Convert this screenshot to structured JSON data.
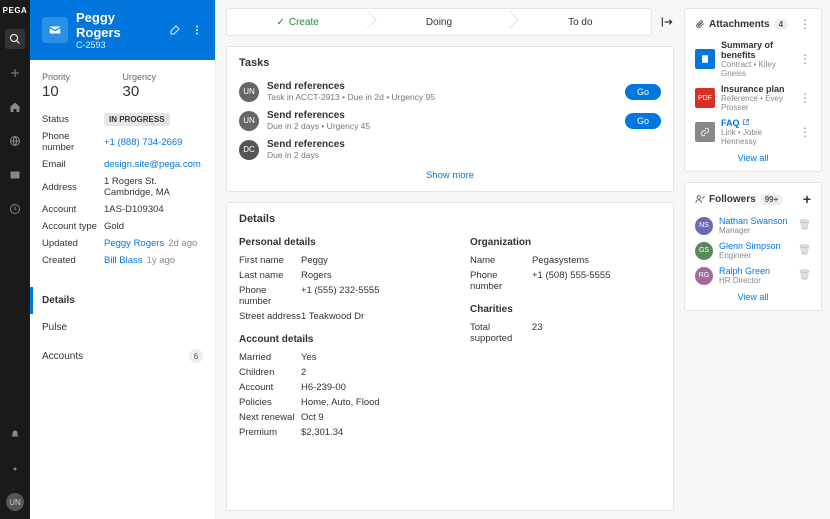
{
  "brand": "PEGA",
  "user_avatar": "UN",
  "case": {
    "title": "Peggy Rogers",
    "id": "C-2593",
    "priority_label": "Priority",
    "priority": "10",
    "urgency_label": "Urgency",
    "urgency": "30",
    "fields": {
      "status_k": "Status",
      "status_v": "IN PROGRESS",
      "phone_k": "Phone number",
      "phone_v": "+1 (888) 734-2669",
      "email_k": "Email",
      "email_v": "design.site@pega.com",
      "address_k": "Address",
      "address_v": "1 Rogers St. Cambridge, MA",
      "account_k": "Account",
      "account_v": "1AS-D109304",
      "accttype_k": "Account type",
      "accttype_v": "Gold",
      "updated_k": "Updated",
      "updated_v": "Peggy Rogers",
      "updated_ago": "2d ago",
      "created_k": "Created",
      "created_v": "Bill Blass",
      "created_ago": "1y ago"
    }
  },
  "side_tabs": {
    "details": "Details",
    "pulse": "Pulse",
    "accounts": "Accounts",
    "accounts_count": "6"
  },
  "stages": {
    "s1": "Create",
    "s2": "Doing",
    "s3": "To do"
  },
  "tasks": {
    "heading": "Tasks",
    "t1": {
      "av": "UN",
      "title": "Send references",
      "sub": "Task in ACCT-2913 • Due in 2d • Urgency 95",
      "btn": "Go"
    },
    "t2": {
      "av": "UN",
      "title": "Send references",
      "sub": "Due in 2 days • Urgency 45",
      "btn": "Go"
    },
    "t3": {
      "av": "DC",
      "title": "Send references",
      "sub": "Due in 2 days"
    },
    "show_more": "Show more"
  },
  "details": {
    "heading": "Details",
    "personal_h": "Personal details",
    "first_k": "First name",
    "first_v": "Peggy",
    "last_k": "Last name",
    "last_v": "Rogers",
    "phone_k": "Phone number",
    "phone_v": "+1 (555) 232-5555",
    "street_k": "Street address",
    "street_v": "1 Teakwood Dr",
    "account_h": "Account details",
    "married_k": "Married",
    "married_v": "Yes",
    "children_k": "Children",
    "children_v": "2",
    "acct_k": "Account",
    "acct_v": "H6-239-00",
    "policies_k": "Policies",
    "policies_v": "Home, Auto, Flood",
    "renew_k": "Next renewal",
    "renew_v": "Oct 9",
    "premium_k": "Premium",
    "premium_v": "$2,301.34",
    "org_h": "Organization",
    "orgname_k": "Name",
    "orgname_v": "Pegasystems",
    "orgphone_k": "Phone number",
    "orgphone_v": "+1 (508) 555-5555",
    "char_h": "Charities",
    "total_k": "Total supported",
    "total_v": "23"
  },
  "attachments": {
    "heading": "Attachments",
    "count": "4",
    "a1": {
      "title": "Summary of benefits",
      "sub": "Contract • Kiley Gneiss"
    },
    "a2": {
      "title": "Insurance plan",
      "sub": "Reference • Evey Prosser"
    },
    "a3": {
      "title": "FAQ",
      "sub": "Link • Jobie Hennessy"
    },
    "view_all": "View all"
  },
  "followers": {
    "heading": "Followers",
    "count": "99+",
    "f1": {
      "av": "NS",
      "name": "Nathan Swanson",
      "role": "Manager",
      "color": "#6b6bb5"
    },
    "f2": {
      "av": "GS",
      "name": "Glenn Simpson",
      "role": "Engineer",
      "color": "#5a8a5a"
    },
    "f3": {
      "av": "RG",
      "name": "Ralph Green",
      "role": "HR Director",
      "color": "#a56b9b"
    },
    "view_all": "View all"
  }
}
